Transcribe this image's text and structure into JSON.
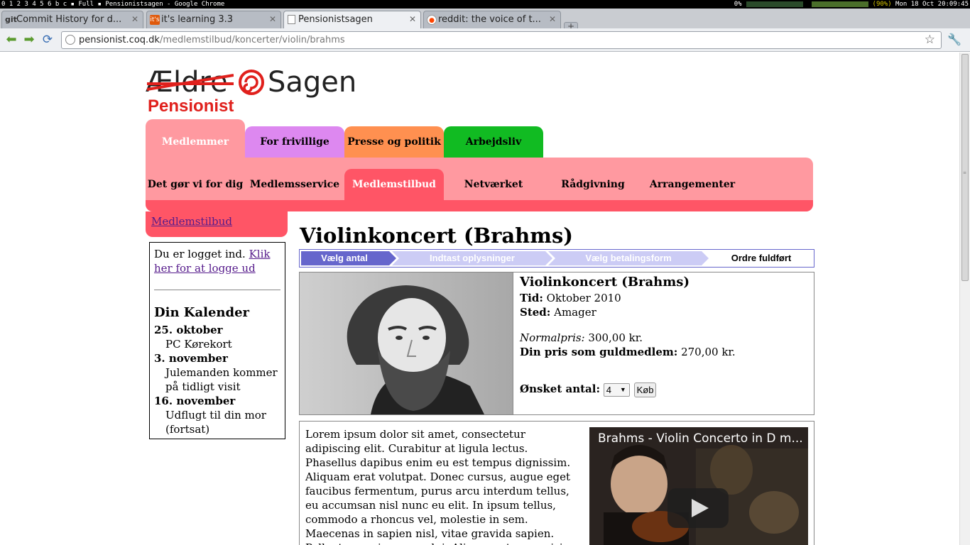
{
  "system_bar": {
    "workspaces": "0 1 2 3 4 5 6 b c",
    "layout": "Full",
    "window_title": "Pensionistsagen - Google Chrome",
    "cpu": "0%",
    "battery": "(90%)",
    "clock": "Mon 18 Oct 20:09:45"
  },
  "browser": {
    "tabs": [
      {
        "label": "Commit History for d...",
        "icon": "git-icon"
      },
      {
        "label": "it's learning 3.3",
        "icon": "its-learning-icon"
      },
      {
        "label": "Pensionistsagen",
        "icon": "document-icon"
      },
      {
        "label": "reddit: the voice of t...",
        "icon": "reddit-icon"
      }
    ],
    "url_host": "pensionist.coq.dk",
    "url_path": "/medlemstilbud/koncerter/violin/brahms"
  },
  "logo": {
    "aeldre": "Ældre",
    "sagen": "Sagen",
    "pensionist": "Pensionist"
  },
  "main_nav": [
    {
      "label": "Medlemmer"
    },
    {
      "label": "For frivillige"
    },
    {
      "label": "Presse og politik"
    },
    {
      "label": "Arbejdsliv"
    }
  ],
  "sub_nav": [
    {
      "label": "Det gør vi for dig"
    },
    {
      "label": "Medlemsservice"
    },
    {
      "label": "Medlemstilbud"
    },
    {
      "label": "Netværket"
    },
    {
      "label": "Rådgivning"
    },
    {
      "label": "Arrangementer"
    }
  ],
  "sidebar": {
    "section_link": "Medlemstilbud",
    "login_text": "Du er logget ind.",
    "logout_link": "Klik her for at logge ud",
    "calendar_title": "Din Kalender",
    "events": [
      {
        "date": "25. oktober",
        "title": "PC Kørekort"
      },
      {
        "date": "3. november",
        "title": "Julemanden kommer på tidligt visit"
      },
      {
        "date": "16. november",
        "title": "Udflugt til din mor (fortsat)"
      }
    ]
  },
  "page_title": "Violinkoncert (Brahms)",
  "steps": [
    "Vælg antal",
    "Indtast oplysninger",
    "Vælg betalingsform",
    "Ordre fuldført"
  ],
  "product": {
    "title": "Violinkoncert (Brahms)",
    "time_label": "Tid:",
    "time_value": "Oktober 2010",
    "place_label": "Sted:",
    "place_value": "Amager",
    "normal_price_label": "Normalpris:",
    "normal_price": "300,00 kr.",
    "member_price_label": "Din pris som guldmedlem:",
    "member_price": "270,00 kr.",
    "qty_label": "Ønsket antal:",
    "qty_value": "4",
    "buy_label": "Køb"
  },
  "description": "Lorem ipsum dolor sit amet, consectetur adipiscing elit. Curabitur at ligula lectus. Phasellus dapibus enim eu est tempus dignissim. Aliquam erat volutpat. Donec cursus, augue eget faucibus fermentum, purus arcu interdum tellus, eu accumsan nisl nunc eu elit. In ipsum tellus, commodo a rhoncus vel, molestie in sem. Maecenas in sapien nisl, vitae gravida sapien. Pellentesque in augue dui. Aliquam et nunc nisi, eget rhoncus ante. In porttitor egestas odio eget",
  "video": {
    "title": "Brahms - Violin Concerto in D m..."
  }
}
